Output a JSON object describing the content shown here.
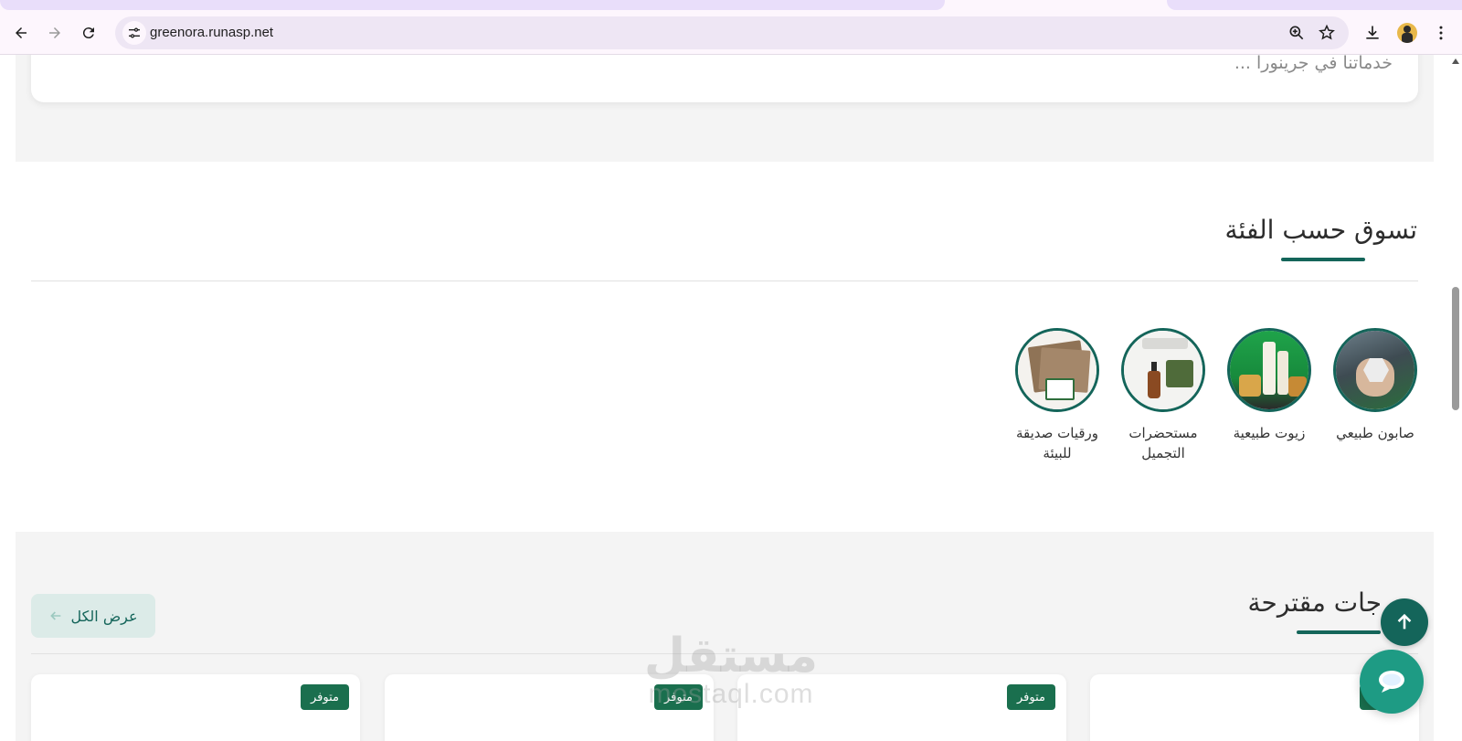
{
  "browser": {
    "url": "greenora.runasp.net",
    "icons": {
      "back": "back-arrow-icon",
      "forward": "forward-arrow-icon",
      "reload": "reload-icon",
      "site_info": "tune-icon",
      "zoom": "zoom-icon",
      "bookmark": "star-icon",
      "download": "download-icon",
      "profile": "avatar",
      "menu": "kebab-menu-icon"
    }
  },
  "intro": {
    "text": "خدماتنا في جرينورا ..."
  },
  "categories": {
    "title": "تسوق حسب الفئة",
    "items": [
      {
        "label": "صابون طبيعي",
        "image": "soap-hand-photo"
      },
      {
        "label": "زيوت طبيعية",
        "image": "oil-bottles-photo"
      },
      {
        "label": "مستحضرات التجميل",
        "image": "cosmetics-set-photo"
      },
      {
        "label": "ورقيات صديقة للبيئة",
        "image": "eco-paper-photo"
      }
    ]
  },
  "suggested": {
    "title": "منتجات مقترحة",
    "title_visible": "جات مقترحة",
    "view_all_label": "عرض الكل",
    "products": [
      {
        "badge": "متوفر"
      },
      {
        "badge": "متوفر"
      },
      {
        "badge": "متوفر"
      },
      {
        "badge": "متوفر"
      }
    ]
  },
  "watermark": {
    "arabic": "مستقل",
    "latin": "mostaql.com"
  },
  "colors": {
    "brand_green": "#14655a",
    "badge_green": "#1a6f4e",
    "chat_green": "#1e9b84",
    "section_gray": "#f4f4f4"
  }
}
